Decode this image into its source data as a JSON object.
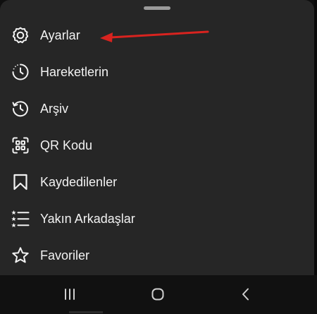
{
  "sheet": {
    "menu_items": [
      {
        "label": "Ayarlar",
        "icon": "settings-gear-icon"
      },
      {
        "label": "Hareketlerin",
        "icon": "activity-clock-icon"
      },
      {
        "label": "Arşiv",
        "icon": "archive-history-icon"
      },
      {
        "label": "QR Kodu",
        "icon": "qr-code-icon"
      },
      {
        "label": "Kaydedilenler",
        "icon": "bookmark-icon"
      },
      {
        "label": "Yakın Arkadaşlar",
        "icon": "close-friends-list-icon"
      },
      {
        "label": "Favoriler",
        "icon": "star-icon"
      }
    ]
  },
  "annotation": {
    "arrow_color": "#d8231f",
    "points_to": "Ayarlar"
  },
  "navbar": {
    "buttons": [
      {
        "icon": "recent-apps-icon"
      },
      {
        "icon": "home-icon"
      },
      {
        "icon": "back-icon"
      }
    ]
  },
  "colors": {
    "sheet_background": "#262626",
    "text": "#f2f2f2",
    "navbar_background": "#111111"
  }
}
